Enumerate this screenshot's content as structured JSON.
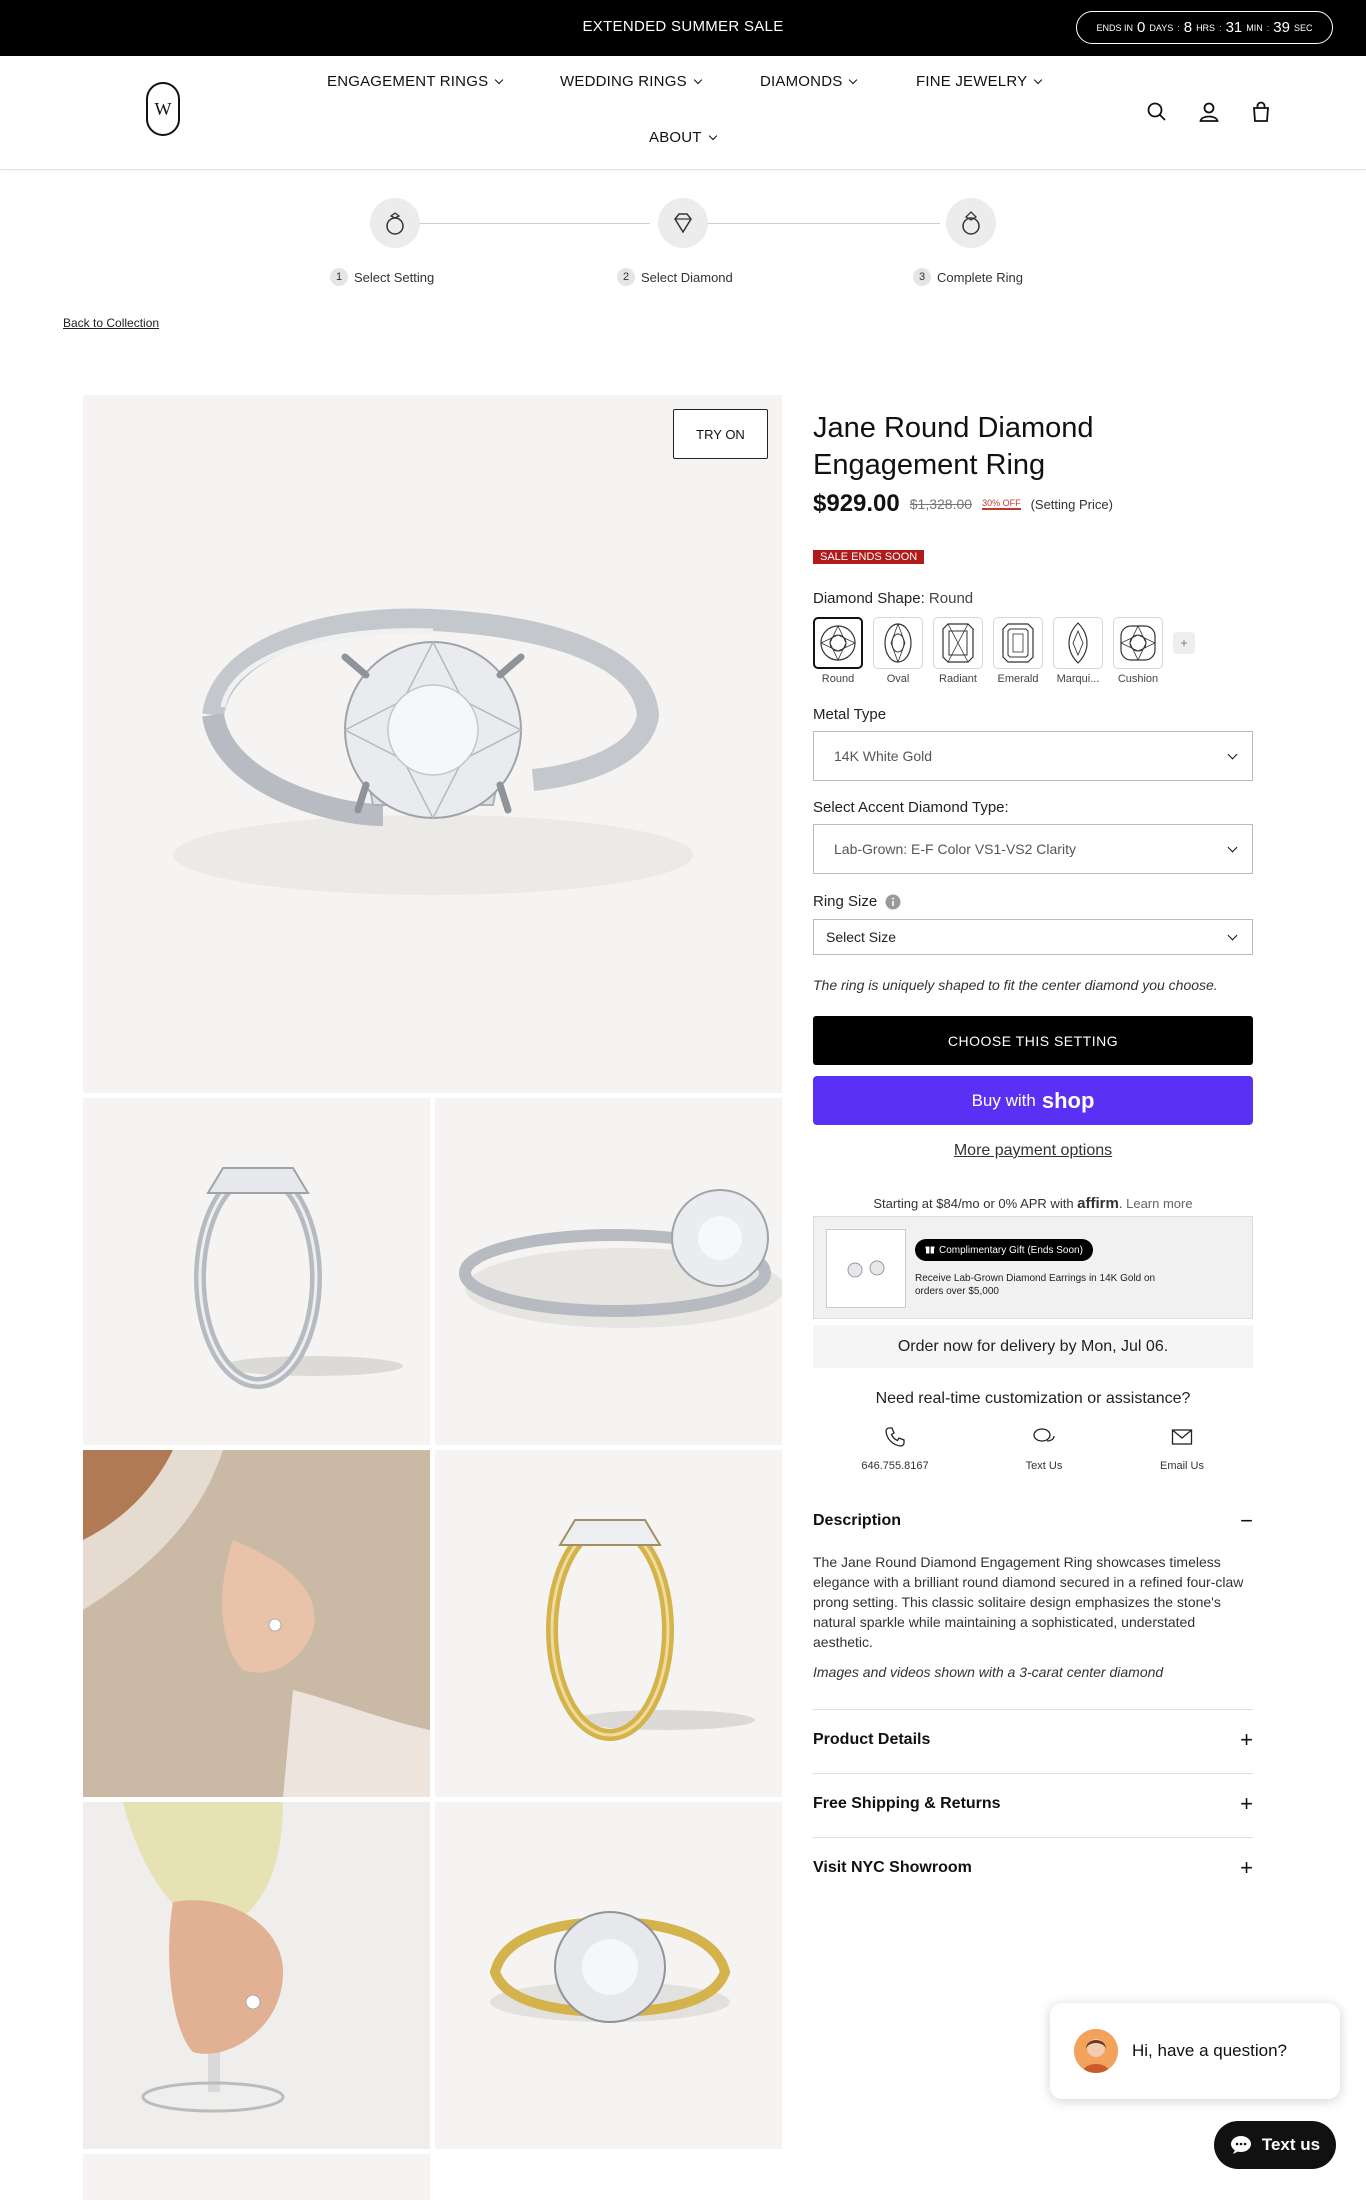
{
  "announcement": {
    "promo": "EXTENDED SUMMER SALE",
    "timer": {
      "prefix": "ENDS IN",
      "days": "0",
      "days_label": "DAYS",
      "hrs": "8",
      "hrs_label": "HRS",
      "min": "31",
      "min_label": "MIN",
      "sec": "39",
      "sec_label": "SEC"
    }
  },
  "nav": {
    "logo": "W",
    "items": [
      "ENGAGEMENT RINGS",
      "WEDDING RINGS",
      "DIAMONDS",
      "FINE JEWELRY",
      "ABOUT"
    ],
    "icons": [
      "search-icon",
      "account-icon",
      "bag-icon"
    ]
  },
  "steps": [
    {
      "num": "1",
      "label": "Select Setting"
    },
    {
      "num": "2",
      "label": "Select Diamond"
    },
    {
      "num": "3",
      "label": "Complete Ring"
    }
  ],
  "back_link": "Back to Collection",
  "gallery": {
    "try_on": "TRY ON"
  },
  "product": {
    "title": "Jane Round Diamond Engagement Ring",
    "price": "$929.00",
    "old_price": "$1,328.00",
    "discount": "30% OFF",
    "price_note": "(Setting Price)",
    "sale_badge": "SALE ENDS SOON"
  },
  "shape": {
    "label": "Diamond Shape:",
    "selected": "Round",
    "options": [
      "Round",
      "Oval",
      "Radiant",
      "Emerald",
      "Marqui...",
      "Cushion"
    ],
    "more": "+"
  },
  "metal": {
    "label": "Metal Type",
    "value": "14K White Gold"
  },
  "accent": {
    "label": "Select Accent Diamond Type:",
    "value": "Lab-Grown: E-F Color VS1-VS2 Clarity"
  },
  "ring_size": {
    "label": "Ring Size",
    "info_icon": "info-icon",
    "value": "Select Size"
  },
  "fit_note": "The ring is uniquely shaped to fit the center diamond you choose.",
  "buttons": {
    "choose": "CHOOSE THIS SETTING",
    "buy_with": "Buy with",
    "shop": "shop",
    "more_payment": "More payment options"
  },
  "affirm": {
    "text": "Starting at $84/mo or 0% APR with",
    "brand": "affirm",
    "learn": "Learn more"
  },
  "gift": {
    "pill": "Complimentary Gift (Ends Soon)",
    "text": "Receive Lab-Grown Diamond Earrings in 14K Gold on orders over $5,000"
  },
  "delivery": "Order now for delivery by Mon, Jul 06.",
  "help": {
    "title": "Need real-time customization or assistance?",
    "phone": "646.755.8167",
    "text": "Text Us",
    "email": "Email Us"
  },
  "accordion": {
    "description_title": "Description",
    "description_body": "The Jane Round Diamond Engagement Ring showcases timeless elegance with a brilliant round diamond secured in a refined four-claw prong setting. This classic solitaire design emphasizes the stone's natural sparkle while maintaining a sophisticated, understated aesthetic.",
    "description_note": "Images and videos shown with a 3-carat center diamond",
    "minus": "−",
    "plus": "+",
    "sections": [
      "Product Details",
      "Free Shipping & Returns",
      "Visit NYC Showroom"
    ]
  },
  "chat": {
    "greeting": "Hi, have a question?",
    "button": "Text us"
  },
  "colors": {
    "shop_purple": "#5a31f4",
    "sale_red": "#b11a1a",
    "discount_red": "#c0392b",
    "white_gold": "#cfd2d6",
    "yellow_gold": "#d4b24c"
  }
}
